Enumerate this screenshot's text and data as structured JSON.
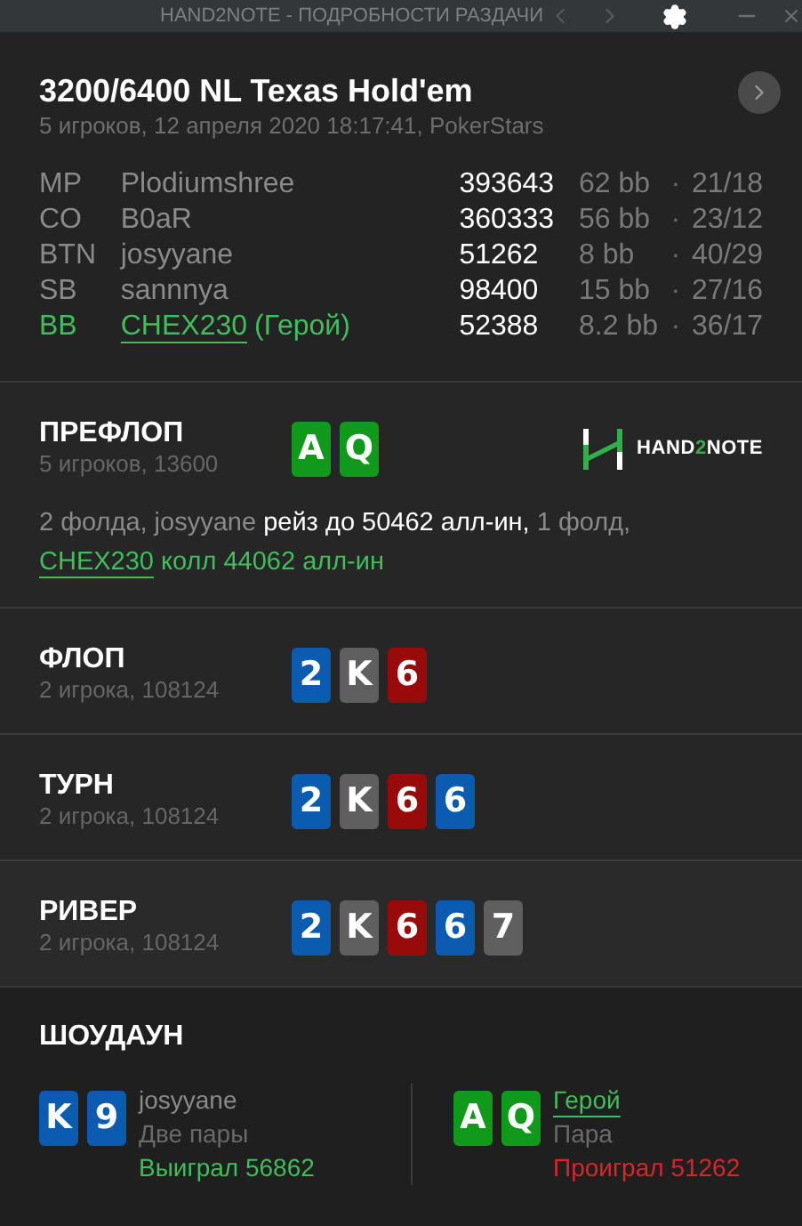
{
  "window": {
    "title": "HAND2NOTE - ПОДРОБНОСТИ РАЗДАЧИ"
  },
  "hand": {
    "title": "3200/6400 NL Texas Hold'em",
    "subtitle": "5 игроков, 12 апреля 2020 18:17:41, PokerStars"
  },
  "players": [
    {
      "position": "MP",
      "name": "Plodiumshree",
      "hero": false,
      "stack": "393643",
      "bb": "62 bb",
      "separator": "·",
      "stats": "21/18"
    },
    {
      "position": "CO",
      "name": "B0aR",
      "hero": false,
      "stack": "360333",
      "bb": "56 bb",
      "separator": "·",
      "stats": "23/12"
    },
    {
      "position": "BTN",
      "name": "josyyane",
      "hero": false,
      "stack": "51262",
      "bb": "8 bb",
      "separator": "·",
      "stats": "40/29"
    },
    {
      "position": "SB",
      "name": "sannnya",
      "hero": false,
      "stack": "98400",
      "bb": "15 bb",
      "separator": "·",
      "stats": "27/16"
    },
    {
      "position": "BB",
      "name": "CHEX230",
      "hero": true,
      "hero_tag": "(Герой)",
      "stack": "52388",
      "bb": "8.2 bb",
      "separator": "·",
      "stats": "36/17"
    }
  ],
  "logo": {
    "before": "HAND",
    "accent": "2",
    "after": "NOTE"
  },
  "streets": [
    {
      "name": "ПРЕФЛОП",
      "info": "5 игроков, 13600",
      "cards": [
        {
          "rank": "A",
          "color": "#0f9a1a"
        },
        {
          "rank": "Q",
          "color": "#0f9a1a"
        }
      ],
      "actions": [
        {
          "kind": "muted",
          "text": "2 фолда, josyyane "
        },
        {
          "kind": "strong",
          "text": "рейз до 50462 алл-ин,"
        },
        {
          "kind": "muted",
          "text": " 1 фолд,"
        },
        {
          "kind": "break"
        },
        {
          "kind": "hero-link",
          "text": "CHEX230"
        },
        {
          "kind": "hero",
          "text": " колл 44062 алл-ин"
        }
      ]
    },
    {
      "name": "ФЛОП",
      "info": "2 игрока, 108124",
      "cards": [
        {
          "rank": "2",
          "color": "#0b5cb0"
        },
        {
          "rank": "K",
          "color": "#5f5f5f"
        },
        {
          "rank": "6",
          "color": "#990a0a"
        }
      ]
    },
    {
      "name": "ТУРН",
      "info": "2 игрока, 108124",
      "cards": [
        {
          "rank": "2",
          "color": "#0b5cb0"
        },
        {
          "rank": "K",
          "color": "#5f5f5f"
        },
        {
          "rank": "6",
          "color": "#990a0a"
        },
        {
          "rank": "6",
          "color": "#0b5cb0"
        }
      ]
    },
    {
      "name": "РИВЕР",
      "info": "2 игрока, 108124",
      "cards": [
        {
          "rank": "2",
          "color": "#0b5cb0"
        },
        {
          "rank": "K",
          "color": "#5f5f5f"
        },
        {
          "rank": "6",
          "color": "#990a0a"
        },
        {
          "rank": "6",
          "color": "#0b5cb0"
        },
        {
          "rank": "7",
          "color": "#5f5f5f"
        }
      ]
    }
  ],
  "showdown": {
    "title": "ШОУДАУН",
    "hands": [
      {
        "cards": [
          {
            "rank": "K",
            "color": "#0b5cb0"
          },
          {
            "rank": "9",
            "color": "#0b5cb0"
          }
        ],
        "player": "josyyane",
        "hero": false,
        "combo": "Две пары",
        "result": "Выиграл 56862",
        "won": true
      },
      {
        "cards": [
          {
            "rank": "A",
            "color": "#0f9a1a"
          },
          {
            "rank": "Q",
            "color": "#0f9a1a"
          }
        ],
        "player": "Герой",
        "hero": true,
        "combo": "Пара",
        "result": "Проиграл 51262",
        "won": false
      }
    ]
  }
}
